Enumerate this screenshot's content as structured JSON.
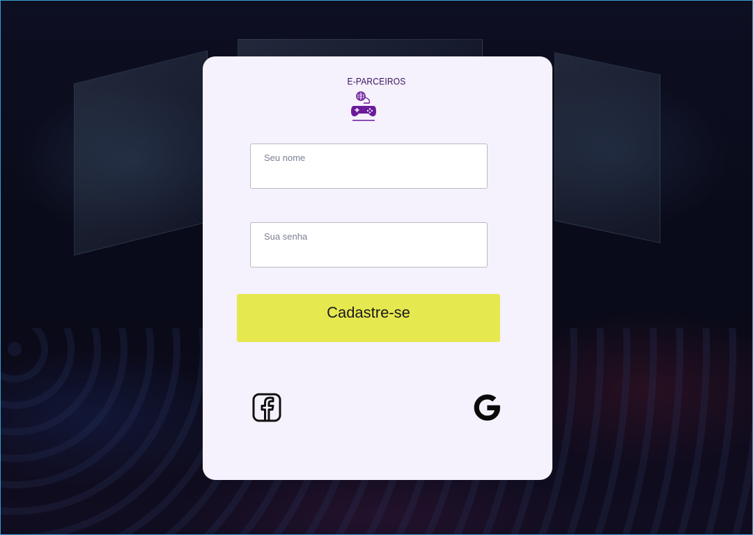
{
  "brand": {
    "name": "E-PARCEIROS",
    "logo_icon": "gamepad-globe-icon",
    "logo_color": "#6a1b9a"
  },
  "form": {
    "name_placeholder": "Seu nome",
    "name_value": "",
    "password_placeholder": "Sua senha",
    "password_value": "",
    "submit_label": "Cadastre-se",
    "submit_color": "#e6e84f"
  },
  "social": {
    "facebook_icon": "facebook-icon",
    "google_icon": "google-icon"
  },
  "theme": {
    "card_background": "#f5f2fd",
    "border_accent": "#3a9fd6"
  }
}
